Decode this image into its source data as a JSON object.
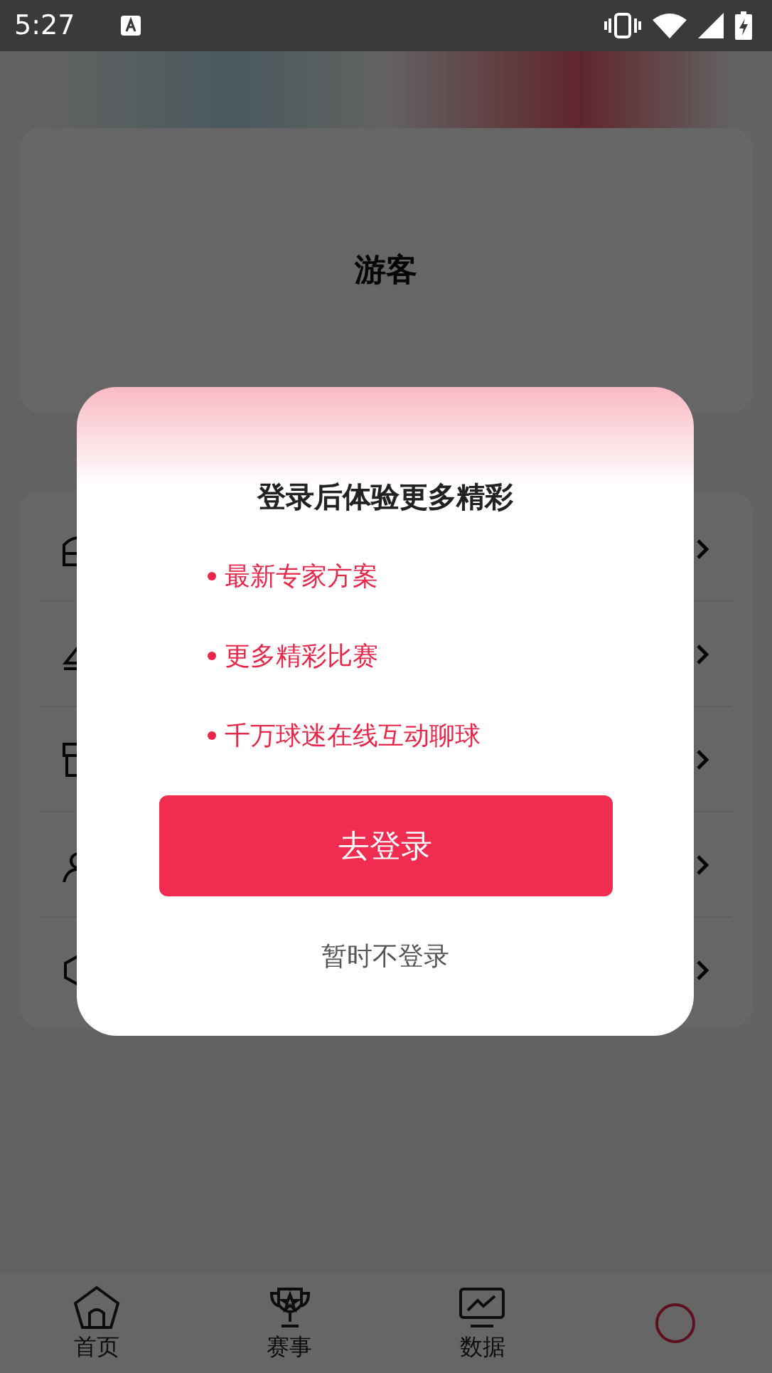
{
  "status_bar": {
    "time": "5:27"
  },
  "profile": {
    "name": "游客"
  },
  "menu": {
    "rows": [
      {
        "kind": "shop"
      },
      {
        "kind": "sign"
      },
      {
        "kind": "gift"
      },
      {
        "kind": "person"
      },
      {
        "kind": "shield"
      }
    ]
  },
  "dialog": {
    "title": "登录后体验更多精彩",
    "features": [
      "最新专家方案",
      "更多精彩比赛",
      "千万球迷在线互动聊球"
    ],
    "login_button": "去登录",
    "skip_link": "暂时不登录"
  },
  "tabs": [
    {
      "kind": "home",
      "label": "首页",
      "selected": false
    },
    {
      "kind": "trophy",
      "label": "赛事",
      "selected": false
    },
    {
      "kind": "chart",
      "label": "数据",
      "selected": false
    },
    {
      "kind": "profile",
      "selected": true
    }
  ]
}
